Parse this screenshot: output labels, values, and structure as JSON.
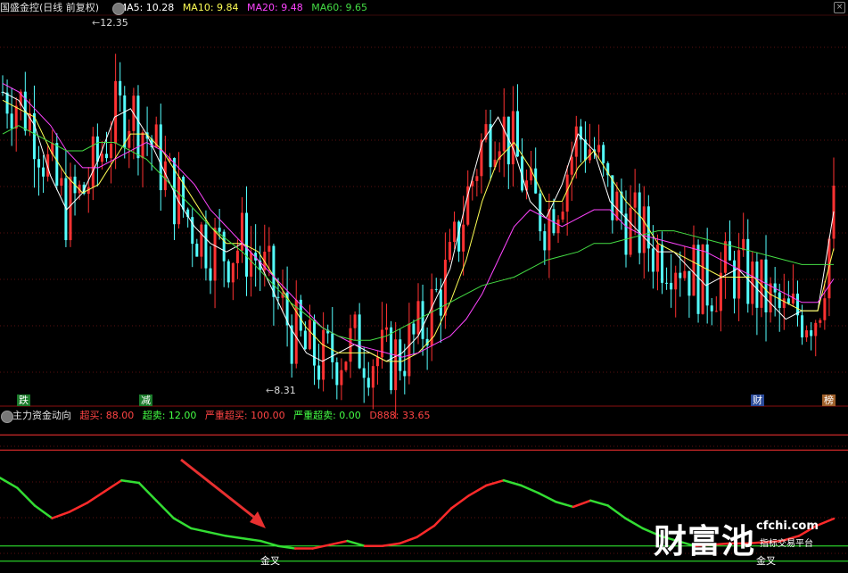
{
  "main_header": {
    "title": "国盛金控(日线 前复权)",
    "ma5_label": "MA5: 10.28",
    "ma10_label": "MA10: 9.84",
    "ma20_label": "MA20: 9.48",
    "ma60_label": "MA60: 9.65",
    "colors": {
      "title": "#e0e0e0",
      "ma5": "#ffffff",
      "ma10": "#ffff55",
      "ma20": "#ff44ff",
      "ma60": "#44dd44"
    }
  },
  "sub_header": {
    "indicator_name": "主力资金动向",
    "overbuy_label": "超买: 88.00",
    "oversell_label": "超卖: 12.00",
    "severe_overbuy_label": "严重超买: 100.00",
    "severe_oversell_label": "严重超卖: 0.00",
    "d888_label": "D888: 33.65",
    "colors": {
      "name": "#e0e0e0",
      "overbuy": "#ff4444",
      "oversell": "#44ff44",
      "severe_overbuy": "#ff4444",
      "severe_oversell": "#44ff44",
      "d888": "#ff4444"
    }
  },
  "price_markers": {
    "high": "12.35",
    "low": "8.31"
  },
  "event_tags": [
    {
      "text": "跌",
      "bg": "#1a7a2a"
    },
    {
      "text": "减",
      "bg": "#1a7a2a"
    },
    {
      "text": "财",
      "bg": "#2a4a9a"
    },
    {
      "text": "榜",
      "bg": "#a0602a"
    }
  ],
  "cross_labels": [
    "金叉",
    "金叉"
  ],
  "watermark": {
    "main": "财富池",
    "url": "cfchi.com",
    "sub": "指标交易平台"
  },
  "chart_data": [
    {
      "type": "candlestick",
      "title": "国盛金控(日线 前复权)",
      "high_marker": 12.35,
      "low_marker": 8.31,
      "ylim": [
        8.0,
        12.6
      ],
      "colors": {
        "up": "#ff3232",
        "down": "#54ffff"
      },
      "series": [
        {
          "name": "MA5",
          "color": "#ffffff",
          "values": [
            11.7,
            11.6,
            11.3,
            10.7,
            10.3,
            10.5,
            10.9,
            11.4,
            11.5,
            11.2,
            10.8,
            10.4,
            10.1,
            9.9,
            9.8,
            9.9,
            9.7,
            9.3,
            8.9,
            8.6,
            8.5,
            8.6,
            8.7,
            8.6,
            8.5,
            8.6,
            8.8,
            9.2,
            9.6,
            10.4,
            11.1,
            11.4,
            11.0,
            10.4,
            10.2,
            10.6,
            11.2,
            11.0,
            10.4,
            10.2,
            10.0,
            9.8,
            9.8,
            9.6,
            9.4,
            9.5,
            9.6,
            9.4,
            9.2,
            9.0,
            9.1,
            9.1,
            10.28
          ]
        },
        {
          "name": "MA10",
          "color": "#ffff55",
          "values": [
            11.6,
            11.5,
            11.4,
            11.0,
            10.7,
            10.5,
            10.6,
            10.9,
            11.2,
            11.2,
            11.0,
            10.7,
            10.4,
            10.1,
            9.9,
            9.9,
            9.8,
            9.5,
            9.2,
            8.9,
            8.7,
            8.6,
            8.6,
            8.6,
            8.5,
            8.5,
            8.6,
            8.8,
            9.2,
            9.7,
            10.4,
            10.9,
            11.1,
            10.8,
            10.4,
            10.4,
            10.8,
            11.0,
            10.7,
            10.4,
            10.2,
            9.9,
            9.8,
            9.7,
            9.6,
            9.5,
            9.5,
            9.5,
            9.3,
            9.2,
            9.1,
            9.1,
            9.84
          ]
        },
        {
          "name": "MA20",
          "color": "#ff44ff",
          "values": [
            11.8,
            11.7,
            11.5,
            11.3,
            11.0,
            10.8,
            10.8,
            10.9,
            11.0,
            11.1,
            11.0,
            10.8,
            10.6,
            10.3,
            10.1,
            9.9,
            9.7,
            9.5,
            9.3,
            9.1,
            8.9,
            8.8,
            8.7,
            8.65,
            8.6,
            8.55,
            8.6,
            8.7,
            8.8,
            9.0,
            9.3,
            9.7,
            10.1,
            10.3,
            10.2,
            10.1,
            10.2,
            10.3,
            10.3,
            10.1,
            10.0,
            9.95,
            9.9,
            9.85,
            9.8,
            9.7,
            9.6,
            9.5,
            9.4,
            9.3,
            9.2,
            9.2,
            9.48
          ]
        },
        {
          "name": "MA60",
          "color": "#44dd44",
          "values": [
            11.2,
            11.3,
            11.2,
            11.1,
            11.0,
            11.0,
            11.1,
            11.1,
            11.0,
            10.9,
            10.7,
            10.5,
            10.3,
            10.1,
            9.95,
            9.8,
            9.6,
            9.4,
            9.2,
            9.05,
            8.9,
            8.8,
            8.75,
            8.75,
            8.8,
            8.9,
            9.0,
            9.1,
            9.2,
            9.3,
            9.4,
            9.45,
            9.5,
            9.6,
            9.7,
            9.75,
            9.8,
            9.9,
            9.9,
            9.95,
            10.0,
            10.05,
            10.05,
            10.0,
            9.95,
            9.9,
            9.85,
            9.8,
            9.75,
            9.7,
            9.65,
            9.65,
            9.65
          ]
        }
      ]
    },
    {
      "type": "line",
      "title": "主力资金动向",
      "ylim": [
        0,
        100
      ],
      "reference_lines": [
        {
          "name": "超买",
          "value": 88,
          "color": "#ff3333"
        },
        {
          "name": "超卖",
          "value": 12,
          "color": "#33ff33"
        },
        {
          "name": "严重超买",
          "value": 100,
          "color": "#ff3333"
        },
        {
          "name": "严重超卖",
          "value": 0,
          "color": "#33ff33"
        }
      ],
      "series": [
        {
          "name": "D888",
          "up_color": "#ff2a2a",
          "down_color": "#33dd33",
          "values": [
            66,
            58,
            44,
            34,
            39,
            46,
            55,
            64,
            62,
            48,
            34,
            26,
            23,
            20,
            18,
            16,
            12,
            10,
            10,
            13,
            16,
            12,
            12,
            14,
            19,
            28,
            42,
            52,
            60,
            64,
            60,
            54,
            47,
            43,
            48,
            44,
            34,
            26,
            20,
            16,
            12,
            13,
            14,
            14,
            15,
            16,
            20,
            28,
            33.65
          ]
        }
      ],
      "cross_points": [
        {
          "label": "金叉",
          "index": 18
        },
        {
          "label": "金叉",
          "index": 43
        }
      ]
    }
  ]
}
